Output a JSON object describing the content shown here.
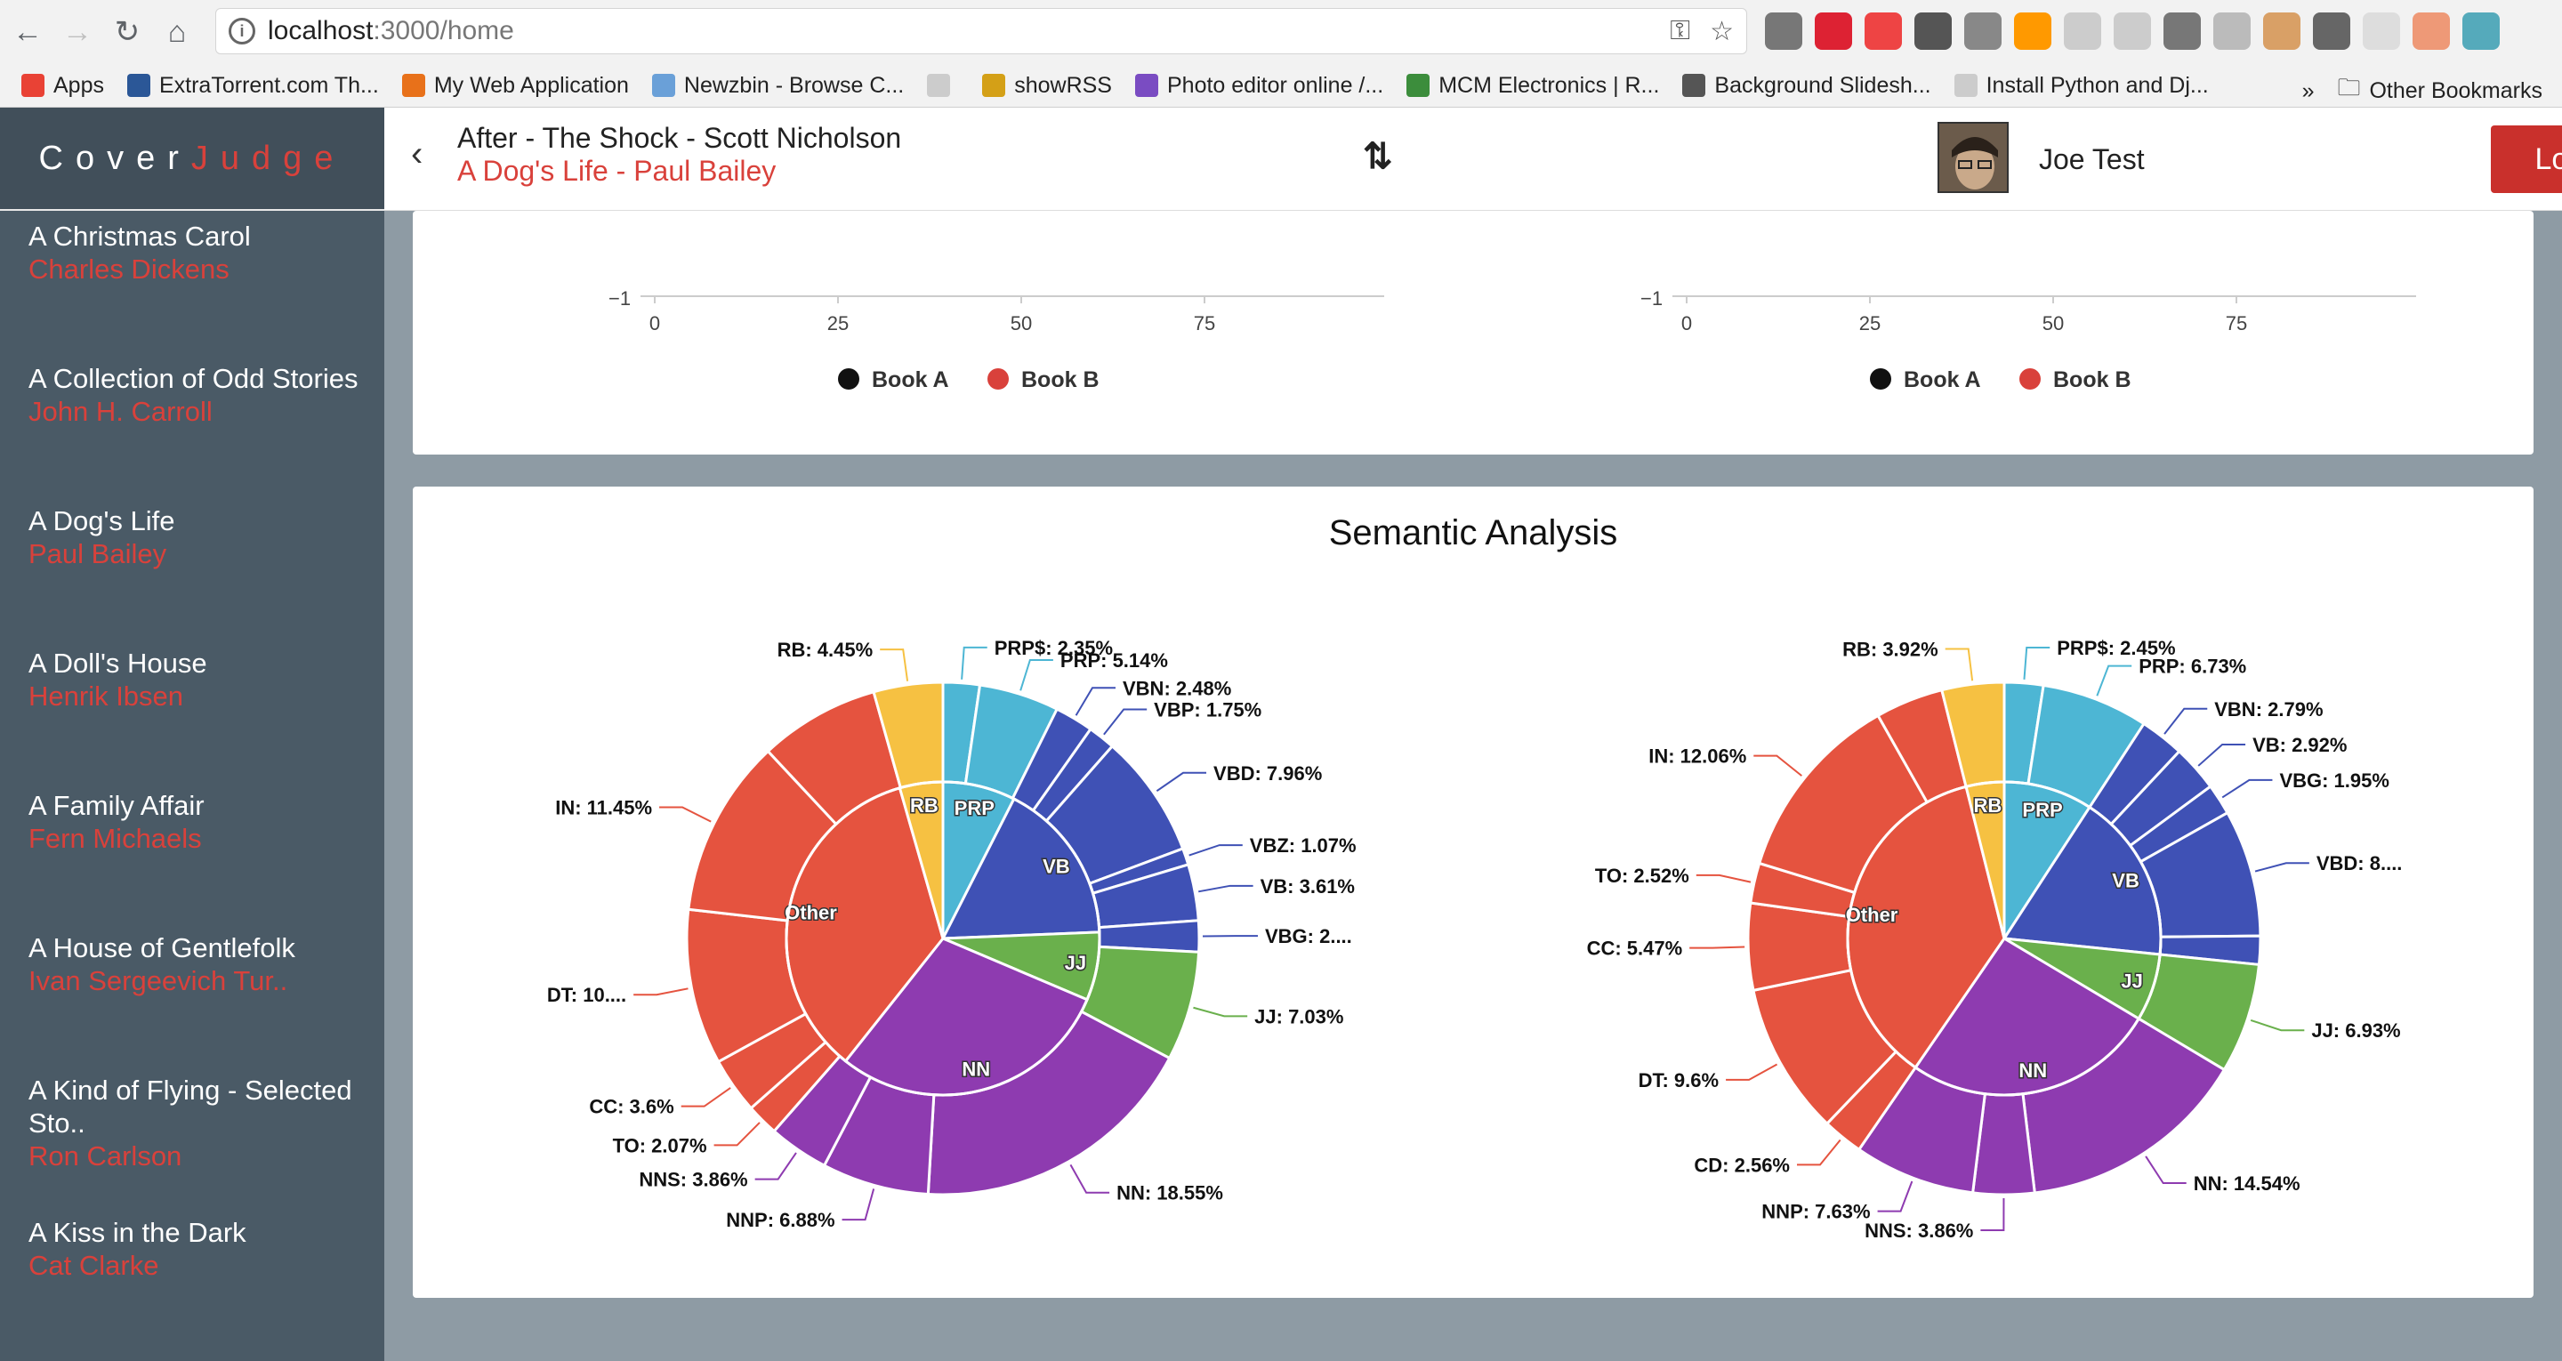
{
  "browser": {
    "url_host": "localhost",
    "url_path": ":3000/home",
    "bookmarks": [
      {
        "label": "Apps",
        "color": "#e94235"
      },
      {
        "label": "ExtraTorrent.com Th...",
        "color": "#2b5797"
      },
      {
        "label": "My Web Application",
        "color": "#e8711a"
      },
      {
        "label": "Newzbin - Browse C...",
        "color": "#6aa0d8"
      },
      {
        "label": "",
        "color": "#cccccc"
      },
      {
        "label": "showRSS",
        "color": "#d4a017"
      },
      {
        "label": "Photo editor online /...",
        "color": "#7a4cc2"
      },
      {
        "label": "MCM Electronics | R...",
        "color": "#3c8d3c"
      },
      {
        "label": "Background Slidesh...",
        "color": "#555555"
      },
      {
        "label": "Install Python and Dj...",
        "color": "#cccccc"
      }
    ],
    "bookmarks_more": "»",
    "other_bookmarks": "Other Bookmarks"
  },
  "app": {
    "brand_a": "Cover",
    "brand_b": "Judge",
    "books": [
      {
        "title": "A Christmas Carol",
        "author": "Charles Dickens"
      },
      {
        "title": "A Collection of Odd Stories",
        "author": "John H. Carroll"
      },
      {
        "title": "A Dog's Life",
        "author": "Paul Bailey"
      },
      {
        "title": "A Doll's House",
        "author": "Henrik Ibsen"
      },
      {
        "title": "A Family Affair",
        "author": "Fern Michaels"
      },
      {
        "title": "A House of Gentlefolk",
        "author": "Ivan Sergeevich Tur.."
      },
      {
        "title": "A Kind of Flying - Selected Sto..",
        "author": "Ron Carlson"
      },
      {
        "title": "A Kiss in the Dark",
        "author": "Cat Clarke"
      }
    ],
    "compare_a": "After - The Shock - Scott Nicholson",
    "compare_b": "A Dog's Life - Paul Bailey",
    "user_name": "Joe Test",
    "logout_label": "Log Out"
  },
  "top_panel": {
    "y_tick": "−1",
    "x_ticks": [
      "0",
      "25",
      "50",
      "75"
    ],
    "legend": [
      {
        "name": "Book A",
        "color": "#111111"
      },
      {
        "name": "Book B",
        "color": "#d9413b"
      }
    ]
  },
  "semantic_title": "Semantic Analysis",
  "chart_data": {
    "type": "pie",
    "colors": {
      "PRP": "#4db6d4",
      "VB": "#3f51b5",
      "JJ": "#6ab04c",
      "NN": "#8e3bb0",
      "Other": "#e5533f",
      "RB": "#f6c142"
    },
    "charts": [
      {
        "inner": [
          {
            "label": "PRP",
            "value": 7.49
          },
          {
            "label": "VB",
            "value": 16.87
          },
          {
            "label": "JJ",
            "value": 7.03
          },
          {
            "label": "NN",
            "value": 29.29
          },
          {
            "label": "Other",
            "value": 34.87
          },
          {
            "label": "RB",
            "value": 4.45
          }
        ],
        "outer": [
          {
            "group": "PRP",
            "label": "PRP$: 2.35%",
            "value": 2.35
          },
          {
            "group": "PRP",
            "label": "PRP: 5.14%",
            "value": 5.14
          },
          {
            "group": "VB",
            "label": "VBN: 2.48%",
            "value": 2.48
          },
          {
            "group": "VB",
            "label": "VBP: 1.75%",
            "value": 1.75
          },
          {
            "group": "VB",
            "label": "VBD: 7.96%",
            "value": 7.96
          },
          {
            "group": "VB",
            "label": "VBZ: 1.07%",
            "value": 1.07
          },
          {
            "group": "VB",
            "label": "VB: 3.61%",
            "value": 3.61
          },
          {
            "group": "VB",
            "label": "VBG: 2....",
            "value": 2.0
          },
          {
            "group": "JJ",
            "label": "JJ: 7.03%",
            "value": 7.03
          },
          {
            "group": "NN",
            "label": "NN: 18.55%",
            "value": 18.55
          },
          {
            "group": "NN",
            "label": "NNP: 6.88%",
            "value": 6.88
          },
          {
            "group": "NN",
            "label": "NNS: 3.86%",
            "value": 3.86
          },
          {
            "group": "Other",
            "label": "TO: 2.07%",
            "value": 2.07
          },
          {
            "group": "Other",
            "label": "CC: 3.6%",
            "value": 3.6
          },
          {
            "group": "Other",
            "label": "DT: 10....",
            "value": 10.0
          },
          {
            "group": "Other",
            "label": "IN: 11.45%",
            "value": 11.45
          },
          {
            "group": "Other",
            "label": "",
            "value": 7.75
          },
          {
            "group": "RB",
            "label": "RB: 4.45%",
            "value": 4.45
          }
        ]
      },
      {
        "inner": [
          {
            "label": "PRP",
            "value": 9.18
          },
          {
            "label": "VB",
            "value": 17.45
          },
          {
            "label": "JJ",
            "value": 6.93
          },
          {
            "label": "NN",
            "value": 26.03
          },
          {
            "label": "Other",
            "value": 36.49
          },
          {
            "label": "RB",
            "value": 3.92
          }
        ],
        "outer": [
          {
            "group": "PRP",
            "label": "PRP$: 2.45%",
            "value": 2.45
          },
          {
            "group": "PRP",
            "label": "PRP: 6.73%",
            "value": 6.73
          },
          {
            "group": "VB",
            "label": "VBN: 2.79%",
            "value": 2.79
          },
          {
            "group": "VB",
            "label": "VB: 2.92%",
            "value": 2.92
          },
          {
            "group": "VB",
            "label": "VBG: 1.95%",
            "value": 1.95
          },
          {
            "group": "VB",
            "label": "VBD: 8....",
            "value": 8.0
          },
          {
            "group": "VB",
            "label": "",
            "value": 1.79
          },
          {
            "group": "JJ",
            "label": "JJ: 6.93%",
            "value": 6.93
          },
          {
            "group": "NN",
            "label": "NN: 14.54%",
            "value": 14.54
          },
          {
            "group": "NN",
            "label": "NNS: 3.86%",
            "value": 3.86
          },
          {
            "group": "NN",
            "label": "NNP: 7.63%",
            "value": 7.63
          },
          {
            "group": "Other",
            "label": "CD: 2.56%",
            "value": 2.56
          },
          {
            "group": "Other",
            "label": "DT: 9.6%",
            "value": 9.6
          },
          {
            "group": "Other",
            "label": "CC: 5.47%",
            "value": 5.47
          },
          {
            "group": "Other",
            "label": "TO: 2.52%",
            "value": 2.52
          },
          {
            "group": "Other",
            "label": "IN: 12.06%",
            "value": 12.06
          },
          {
            "group": "Other",
            "label": "",
            "value": 4.28
          },
          {
            "group": "RB",
            "label": "RB: 3.92%",
            "value": 3.92
          }
        ]
      }
    ]
  }
}
